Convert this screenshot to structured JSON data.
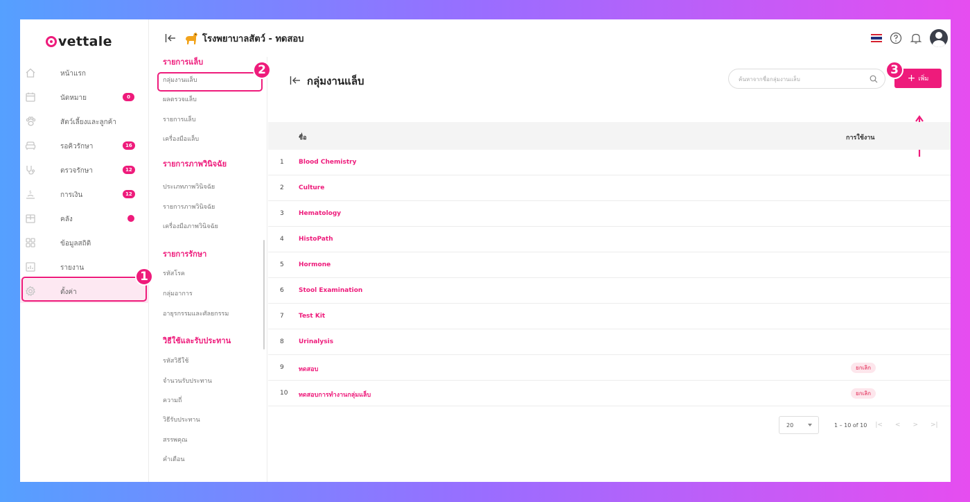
{
  "brand": {
    "name": "vettale",
    "accent": "#ee1b7b"
  },
  "sidebar": {
    "items": [
      {
        "label": "หน้าแรก",
        "icon": "home-icon"
      },
      {
        "label": "นัดหมาย",
        "icon": "calendar-icon",
        "badge": "0"
      },
      {
        "label": "สัตว์เลี้ยงและลูกค้า",
        "icon": "paw-icon"
      },
      {
        "label": "รอคิวรักษา",
        "icon": "sofa-icon",
        "badge": "16"
      },
      {
        "label": "ตรวจรักษา",
        "icon": "stethoscope-icon",
        "badge": "12"
      },
      {
        "label": "การเงิน",
        "icon": "money-icon",
        "badge": "12"
      },
      {
        "label": "คลัง",
        "icon": "box-icon"
      },
      {
        "label": "ข้อมูลสถิติ",
        "icon": "grid-icon"
      },
      {
        "label": "รายงาน",
        "icon": "chart-icon"
      },
      {
        "label": "ตั้งค่า",
        "icon": "gear-icon"
      }
    ]
  },
  "topbar": {
    "hospital": "โรงพยาบาลสัตว์ - ทดสอบ"
  },
  "submenu": {
    "sections": [
      {
        "title": "รายการแล็บ",
        "items": [
          "กลุ่มงานแล็บ",
          "ผลตรวจแล็บ",
          "รายการแล็บ",
          "เครื่องมือแล็บ"
        ]
      },
      {
        "title": "รายการภาพวินิจฉัย",
        "items": [
          "ประเภทภาพวินิจฉัย",
          "รายการภาพวินิจฉัย",
          "เครื่องมือภาพวินิจฉัย"
        ]
      },
      {
        "title": "รายการรักษา",
        "items": [
          "รหัสโรค",
          "กลุ่มอาการ",
          "อายุรกรรมและศัลยกรรม"
        ]
      },
      {
        "title": "วิธีใช้และรับประทาน",
        "items": [
          "รหัสวิธีใช้",
          "จำนวนรับประทาน",
          "ความถี่",
          "วิธีรับประทาน",
          "สรรพคุณ",
          "คำเตือน"
        ]
      }
    ]
  },
  "main": {
    "title": "กลุ่มงานแล็บ",
    "search_placeholder": "ค้นหาจากชื่อกลุ่มงานแล็บ",
    "add_label": "เพิ่ม",
    "columns": {
      "name": "ชื่อ",
      "status": "การใช้งาน"
    },
    "rows": [
      {
        "idx": "1",
        "name": "Blood Chemistry",
        "status": ""
      },
      {
        "idx": "2",
        "name": "Culture",
        "status": ""
      },
      {
        "idx": "3",
        "name": "Hematology",
        "status": ""
      },
      {
        "idx": "4",
        "name": "HistoPath",
        "status": ""
      },
      {
        "idx": "5",
        "name": "Hormone",
        "status": ""
      },
      {
        "idx": "6",
        "name": "Stool Examination",
        "status": ""
      },
      {
        "idx": "7",
        "name": "Test Kit",
        "status": ""
      },
      {
        "idx": "8",
        "name": "Urinalysis",
        "status": ""
      },
      {
        "idx": "9",
        "name": "ทดสอบ",
        "status": "ยกเลิก"
      },
      {
        "idx": "10",
        "name": "ทดสอบการทำงานกลุ่มแล็บ",
        "status": "ยกเลิก"
      }
    ],
    "pager": {
      "page_size": "20",
      "range": "1 – 10 of 10"
    }
  },
  "steps": [
    "1",
    "2",
    "3"
  ]
}
